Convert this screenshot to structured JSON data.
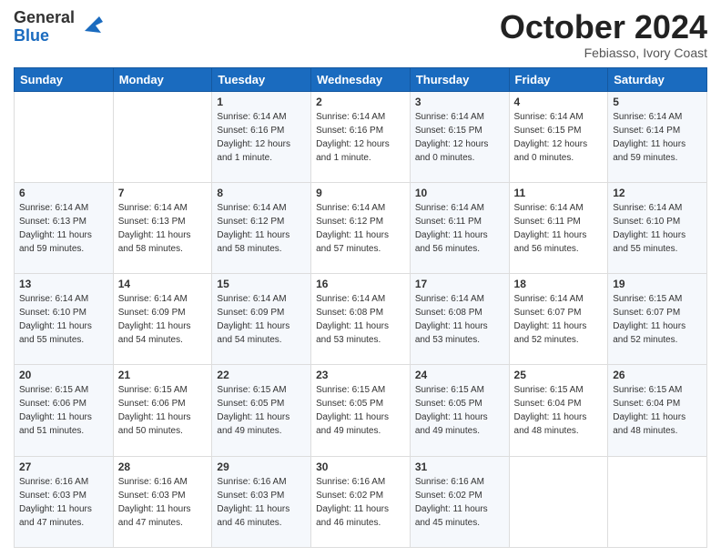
{
  "header": {
    "logo_line1": "General",
    "logo_line2": "Blue",
    "month": "October 2024",
    "location": "Febiasso, Ivory Coast"
  },
  "weekdays": [
    "Sunday",
    "Monday",
    "Tuesday",
    "Wednesday",
    "Thursday",
    "Friday",
    "Saturday"
  ],
  "weeks": [
    [
      {
        "day": "",
        "sunrise": "",
        "sunset": "",
        "daylight": ""
      },
      {
        "day": "",
        "sunrise": "",
        "sunset": "",
        "daylight": ""
      },
      {
        "day": "1",
        "sunrise": "Sunrise: 6:14 AM",
        "sunset": "Sunset: 6:16 PM",
        "daylight": "Daylight: 12 hours and 1 minute."
      },
      {
        "day": "2",
        "sunrise": "Sunrise: 6:14 AM",
        "sunset": "Sunset: 6:16 PM",
        "daylight": "Daylight: 12 hours and 1 minute."
      },
      {
        "day": "3",
        "sunrise": "Sunrise: 6:14 AM",
        "sunset": "Sunset: 6:15 PM",
        "daylight": "Daylight: 12 hours and 0 minutes."
      },
      {
        "day": "4",
        "sunrise": "Sunrise: 6:14 AM",
        "sunset": "Sunset: 6:15 PM",
        "daylight": "Daylight: 12 hours and 0 minutes."
      },
      {
        "day": "5",
        "sunrise": "Sunrise: 6:14 AM",
        "sunset": "Sunset: 6:14 PM",
        "daylight": "Daylight: 11 hours and 59 minutes."
      }
    ],
    [
      {
        "day": "6",
        "sunrise": "Sunrise: 6:14 AM",
        "sunset": "Sunset: 6:13 PM",
        "daylight": "Daylight: 11 hours and 59 minutes."
      },
      {
        "day": "7",
        "sunrise": "Sunrise: 6:14 AM",
        "sunset": "Sunset: 6:13 PM",
        "daylight": "Daylight: 11 hours and 58 minutes."
      },
      {
        "day": "8",
        "sunrise": "Sunrise: 6:14 AM",
        "sunset": "Sunset: 6:12 PM",
        "daylight": "Daylight: 11 hours and 58 minutes."
      },
      {
        "day": "9",
        "sunrise": "Sunrise: 6:14 AM",
        "sunset": "Sunset: 6:12 PM",
        "daylight": "Daylight: 11 hours and 57 minutes."
      },
      {
        "day": "10",
        "sunrise": "Sunrise: 6:14 AM",
        "sunset": "Sunset: 6:11 PM",
        "daylight": "Daylight: 11 hours and 56 minutes."
      },
      {
        "day": "11",
        "sunrise": "Sunrise: 6:14 AM",
        "sunset": "Sunset: 6:11 PM",
        "daylight": "Daylight: 11 hours and 56 minutes."
      },
      {
        "day": "12",
        "sunrise": "Sunrise: 6:14 AM",
        "sunset": "Sunset: 6:10 PM",
        "daylight": "Daylight: 11 hours and 55 minutes."
      }
    ],
    [
      {
        "day": "13",
        "sunrise": "Sunrise: 6:14 AM",
        "sunset": "Sunset: 6:10 PM",
        "daylight": "Daylight: 11 hours and 55 minutes."
      },
      {
        "day": "14",
        "sunrise": "Sunrise: 6:14 AM",
        "sunset": "Sunset: 6:09 PM",
        "daylight": "Daylight: 11 hours and 54 minutes."
      },
      {
        "day": "15",
        "sunrise": "Sunrise: 6:14 AM",
        "sunset": "Sunset: 6:09 PM",
        "daylight": "Daylight: 11 hours and 54 minutes."
      },
      {
        "day": "16",
        "sunrise": "Sunrise: 6:14 AM",
        "sunset": "Sunset: 6:08 PM",
        "daylight": "Daylight: 11 hours and 53 minutes."
      },
      {
        "day": "17",
        "sunrise": "Sunrise: 6:14 AM",
        "sunset": "Sunset: 6:08 PM",
        "daylight": "Daylight: 11 hours and 53 minutes."
      },
      {
        "day": "18",
        "sunrise": "Sunrise: 6:14 AM",
        "sunset": "Sunset: 6:07 PM",
        "daylight": "Daylight: 11 hours and 52 minutes."
      },
      {
        "day": "19",
        "sunrise": "Sunrise: 6:15 AM",
        "sunset": "Sunset: 6:07 PM",
        "daylight": "Daylight: 11 hours and 52 minutes."
      }
    ],
    [
      {
        "day": "20",
        "sunrise": "Sunrise: 6:15 AM",
        "sunset": "Sunset: 6:06 PM",
        "daylight": "Daylight: 11 hours and 51 minutes."
      },
      {
        "day": "21",
        "sunrise": "Sunrise: 6:15 AM",
        "sunset": "Sunset: 6:06 PM",
        "daylight": "Daylight: 11 hours and 50 minutes."
      },
      {
        "day": "22",
        "sunrise": "Sunrise: 6:15 AM",
        "sunset": "Sunset: 6:05 PM",
        "daylight": "Daylight: 11 hours and 49 minutes."
      },
      {
        "day": "23",
        "sunrise": "Sunrise: 6:15 AM",
        "sunset": "Sunset: 6:05 PM",
        "daylight": "Daylight: 11 hours and 49 minutes."
      },
      {
        "day": "24",
        "sunrise": "Sunrise: 6:15 AM",
        "sunset": "Sunset: 6:05 PM",
        "daylight": "Daylight: 11 hours and 49 minutes."
      },
      {
        "day": "25",
        "sunrise": "Sunrise: 6:15 AM",
        "sunset": "Sunset: 6:04 PM",
        "daylight": "Daylight: 11 hours and 48 minutes."
      },
      {
        "day": "26",
        "sunrise": "Sunrise: 6:15 AM",
        "sunset": "Sunset: 6:04 PM",
        "daylight": "Daylight: 11 hours and 48 minutes."
      }
    ],
    [
      {
        "day": "27",
        "sunrise": "Sunrise: 6:16 AM",
        "sunset": "Sunset: 6:03 PM",
        "daylight": "Daylight: 11 hours and 47 minutes."
      },
      {
        "day": "28",
        "sunrise": "Sunrise: 6:16 AM",
        "sunset": "Sunset: 6:03 PM",
        "daylight": "Daylight: 11 hours and 47 minutes."
      },
      {
        "day": "29",
        "sunrise": "Sunrise: 6:16 AM",
        "sunset": "Sunset: 6:03 PM",
        "daylight": "Daylight: 11 hours and 46 minutes."
      },
      {
        "day": "30",
        "sunrise": "Sunrise: 6:16 AM",
        "sunset": "Sunset: 6:02 PM",
        "daylight": "Daylight: 11 hours and 46 minutes."
      },
      {
        "day": "31",
        "sunrise": "Sunrise: 6:16 AM",
        "sunset": "Sunset: 6:02 PM",
        "daylight": "Daylight: 11 hours and 45 minutes."
      },
      {
        "day": "",
        "sunrise": "",
        "sunset": "",
        "daylight": ""
      },
      {
        "day": "",
        "sunrise": "",
        "sunset": "",
        "daylight": ""
      }
    ]
  ]
}
